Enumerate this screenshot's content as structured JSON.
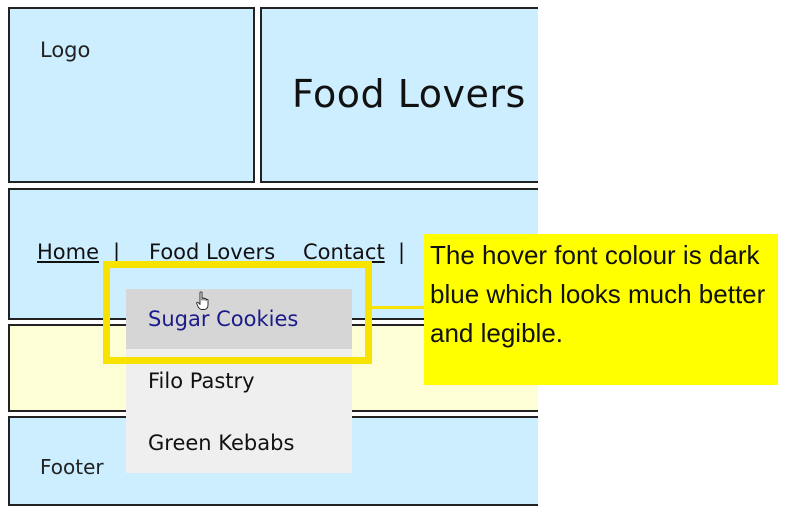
{
  "header": {
    "logo_label": "Logo",
    "site_title": "Food Lovers"
  },
  "nav": {
    "items": [
      {
        "label": "Home"
      },
      {
        "label": "Food Lovers"
      },
      {
        "label": "Contact"
      }
    ],
    "separator": "|"
  },
  "dropdown": {
    "items": [
      {
        "label": "Sugar Cookies"
      },
      {
        "label": "Filo Pastry"
      },
      {
        "label": "Green Kebabs"
      }
    ],
    "hover_color": "#1a1a8a"
  },
  "footer": {
    "label": "Footer"
  },
  "annotation": {
    "callout_text": "The hover font colour is dark blue which looks much better and legible.",
    "highlight_color": "#f7e200",
    "callout_background": "#ffff00"
  },
  "colors": {
    "section_background": "#cdeeff",
    "main_background": "#fdfdd6"
  }
}
